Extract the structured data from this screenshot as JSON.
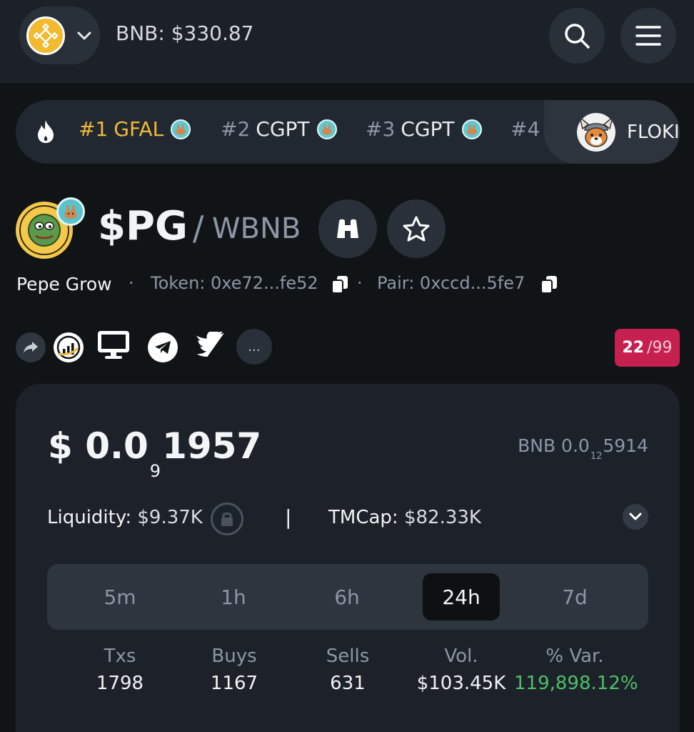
{
  "header": {
    "chain_icon": "bnb-chain-logo",
    "bnb_price": "BNB: $330.87",
    "icons": [
      "chevron-down-icon",
      "search-icon",
      "menu-icon"
    ]
  },
  "ticker": {
    "icon": "fire-icon",
    "items": [
      {
        "rank": "#1",
        "symbol": "GFAL",
        "highlight": true
      },
      {
        "rank": "#2",
        "symbol": "CGPT",
        "highlight": false
      },
      {
        "rank": "#3",
        "symbol": "CGPT",
        "highlight": false
      },
      {
        "rank": "#4",
        "symbol": "",
        "highlight": false
      }
    ],
    "promo": {
      "name": "FLOKI",
      "icon": "floki-logo"
    }
  },
  "pair": {
    "symbol": "$PG",
    "slash": "/",
    "quote": "WBNB",
    "name": "Pepe Grow",
    "dot": "·",
    "token": "Token: 0xe72...fe52",
    "pair_address": "Pair: 0xccd...5fe7"
  },
  "social": {
    "more": "...",
    "icons": [
      "share-icon",
      "chart-logo-icon",
      "monitor-icon",
      "telegram-icon",
      "twitter-icon"
    ]
  },
  "score": {
    "value": "22",
    "total": "/99"
  },
  "price": {
    "usd_prefix": "$ 0.0",
    "usd_sub": "9",
    "usd_tail": "1957",
    "bnb_prefix": "BNB 0.0",
    "bnb_sub": "12",
    "bnb_tail": "5914"
  },
  "stats": {
    "liquidity_label": "Liquidity:",
    "liquidity_value": "$9.37K",
    "separator": "|",
    "tmcap_label": "TMCap:",
    "tmcap_value": "$82.33K"
  },
  "timeframes": {
    "options": [
      "5m",
      "1h",
      "6h",
      "24h",
      "7d"
    ],
    "active": "24h"
  },
  "metrics": [
    {
      "label": "Txs",
      "value": "1798"
    },
    {
      "label": "Buys",
      "value": "1167"
    },
    {
      "label": "Sells",
      "value": "631"
    },
    {
      "label": "Vol.",
      "value": "$103.45K"
    },
    {
      "label": "% Var.",
      "value": "119,898.12%"
    }
  ],
  "colors": {
    "accent_gold": "#f0b93a",
    "score_bg": "#c5204f",
    "positive": "#4cc067",
    "bg": "#111417"
  }
}
